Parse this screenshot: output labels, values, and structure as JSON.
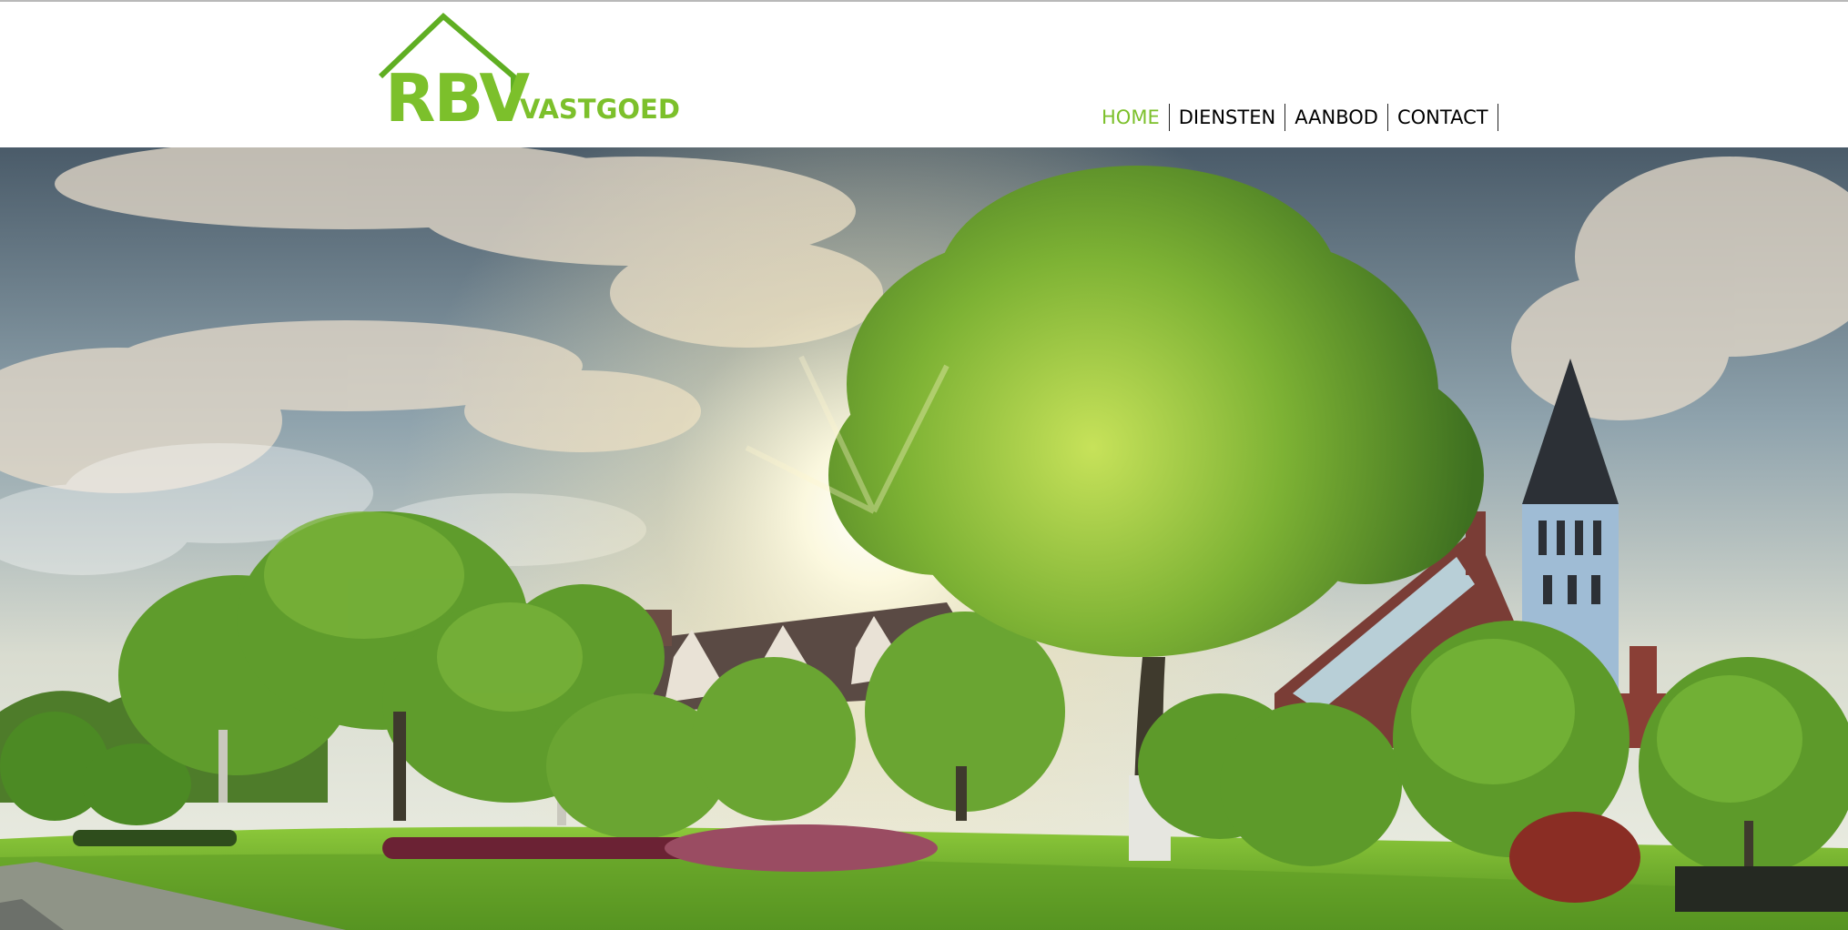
{
  "brand": {
    "logo_primary": "RBV",
    "logo_secondary": "VASTGOED",
    "color": "#7cc02b"
  },
  "nav": {
    "items": [
      {
        "label": "HOME",
        "active": true
      },
      {
        "label": "DIENSTEN",
        "active": false
      },
      {
        "label": "AANBOD",
        "active": false
      },
      {
        "label": "CONTACT",
        "active": false
      }
    ],
    "active_color": "#7cc02b",
    "text_color": "#000000"
  },
  "hero": {
    "image": "landscape-photo",
    "icon": "image-icon"
  }
}
